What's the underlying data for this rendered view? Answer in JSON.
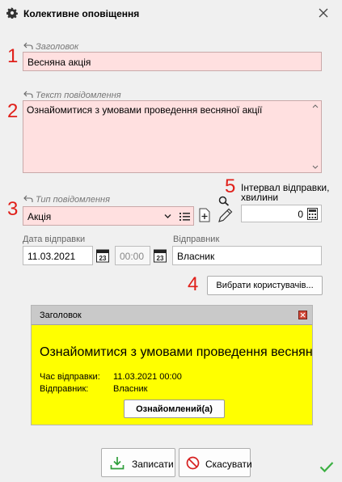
{
  "window": {
    "title": "Колективне оповіщення",
    "gear_icon": "gear-icon",
    "close_icon": "close-icon"
  },
  "annotations": {
    "n1": "1",
    "n2": "2",
    "n3": "3",
    "n4": "4",
    "n5": "5"
  },
  "header": {
    "label": "Заголовок",
    "value": "Весняна акція"
  },
  "message": {
    "label": "Текст повідомлення",
    "value": "Ознайомитися з умовами проведення весняної акції"
  },
  "message_type": {
    "label": "Тип повідомлення",
    "value": "Акція"
  },
  "interval": {
    "label": "Інтервал відправки, хвилини",
    "value": "0"
  },
  "send_date": {
    "label": "Дата відправки",
    "date": "11.03.2021",
    "time": "00:00"
  },
  "sender": {
    "label": "Відправник",
    "value": "Власник"
  },
  "select_users_button": "Вибрати користувачів...",
  "preview": {
    "title": "Заголовок",
    "message": "Ознайомитися з умовами проведення весняної акції",
    "send_time_label": "Час відправки:",
    "send_time_value": "11.03.2021 00:00",
    "sender_label": "Відправник:",
    "sender_value": "Власник",
    "ack_button": "Ознайомлений(а)"
  },
  "footer": {
    "save_label": "Записати",
    "cancel_label": "Скасувати"
  },
  "colors": {
    "required_field": "#ffe0e0",
    "preview_bg": "#ffff00",
    "annotation": "#e0201a",
    "checkmark": "#3cb043"
  }
}
